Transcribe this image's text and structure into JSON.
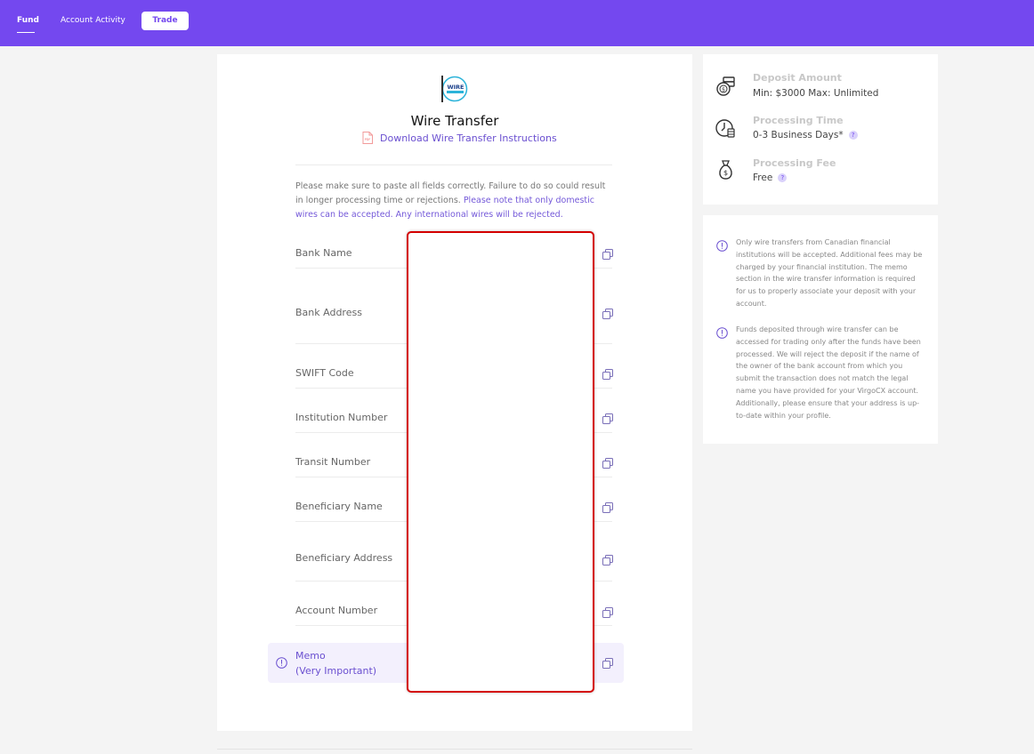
{
  "nav": {
    "fund": "Fund",
    "account_activity": "Account Activity",
    "trade": "Trade"
  },
  "main": {
    "logo_text": "WIRE",
    "title": "Wire Transfer",
    "download_link": "Download Wire Transfer Instructions",
    "pdf_label": "PDF",
    "notice_plain": "Please make sure to paste all fields correctly. Failure to do so could result in longer processing time or rejections. ",
    "notice_highlight": "Please note that only domestic wires can be accepted. Any international wires will be rejected.",
    "fields": [
      "Bank Name",
      "Bank Address",
      "SWIFT Code",
      "Institution Number",
      "Transit Number",
      "Beneficiary Name",
      "Beneficiary Address",
      "Account Number"
    ],
    "memo_line1": "Memo",
    "memo_line2": "(Very Important)"
  },
  "sidebar": {
    "deposit_amount_title": "Deposit Amount",
    "deposit_amount_value": "Min: $3000 Max: Unlimited",
    "processing_time_title": "Processing Time",
    "processing_time_value": "0-3 Business Days*",
    "processing_fee_title": "Processing Fee",
    "processing_fee_value": "Free",
    "help_glyph": "?"
  },
  "notes": [
    "Only wire transfers from Canadian financial institutions will be accepted. Additional fees may be charged by your financial institution. The memo section in the wire transfer information is required for us to properly associate your deposit with your account.",
    "Funds deposited through wire transfer can be accessed for trading only after the funds have been processed. We will reject the deposit if the name of the owner of the bank account from which you submit the transaction does not match the legal name you have provided for your VirgoCX account. Additionally, please ensure that your address is up-to-date within your profile."
  ],
  "colors": {
    "brand": "#7448ef",
    "link": "#6a4fd0",
    "redaction_border": "#d40000"
  }
}
